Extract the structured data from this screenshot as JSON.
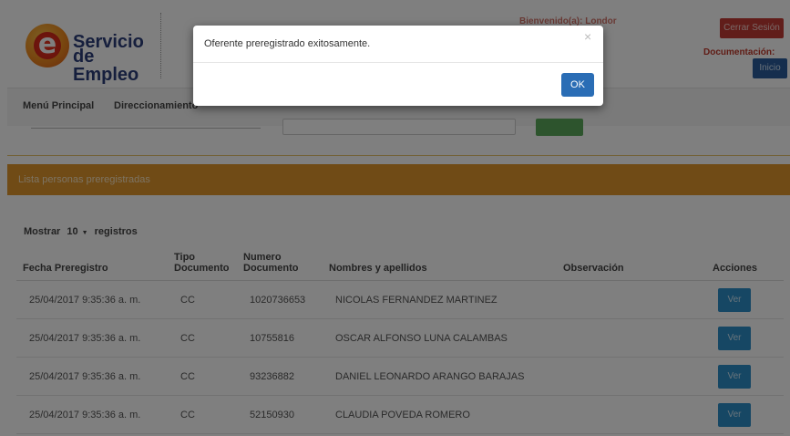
{
  "header": {
    "logo_line1": "Servicio",
    "logo_line2": "de Empleo",
    "logo_letter": "e",
    "faint_text": "Bienvenido(a): Londor",
    "logout_label": "Cerrar Sesión",
    "documentation_label": "Documentación:",
    "home_label": "Inicio"
  },
  "nav": {
    "items": [
      {
        "label": "Menú Principal"
      },
      {
        "label": "Direccionamiento"
      }
    ]
  },
  "panel": {
    "title": "Lista personas preregistradas",
    "length_prefix": "Mostrar",
    "length_value": "10",
    "length_suffix": "registros"
  },
  "table": {
    "columns": [
      "Fecha Preregistro",
      "Tipo Documento",
      "Numero Documento",
      "Nombres y apellidos",
      "Observación",
      "Acciones"
    ],
    "rows": [
      {
        "fecha": "25/04/2017 9:35:36 a. m.",
        "tipo": "CC",
        "numero": "1020736653",
        "nombre": "NICOLAS FERNANDEZ MARTINEZ",
        "observacion": "",
        "accion": "Ver"
      },
      {
        "fecha": "25/04/2017 9:35:36 a. m.",
        "tipo": "CC",
        "numero": "10755816",
        "nombre": "OSCAR ALFONSO LUNA CALAMBAS",
        "observacion": "",
        "accion": "Ver"
      },
      {
        "fecha": "25/04/2017 9:35:36 a. m.",
        "tipo": "CC",
        "numero": "93236882",
        "nombre": "DANIEL LEONARDO ARANGO BARAJAS",
        "observacion": "",
        "accion": "Ver"
      },
      {
        "fecha": "25/04/2017 9:35:36 a. m.",
        "tipo": "CC",
        "numero": "52150930",
        "nombre": "CLAUDIA POVEDA ROMERO",
        "observacion": "",
        "accion": "Ver"
      }
    ]
  },
  "modal": {
    "message": "Oferente preregistrado exitosamente.",
    "close_glyph": "×",
    "ok_label": "OK"
  },
  "colors": {
    "panel_header": "#e0972c",
    "logout_button": "#c23b34",
    "home_button": "#2a5d9c",
    "view_button": "#2d8fc9",
    "ok_button": "#2a6db5"
  }
}
